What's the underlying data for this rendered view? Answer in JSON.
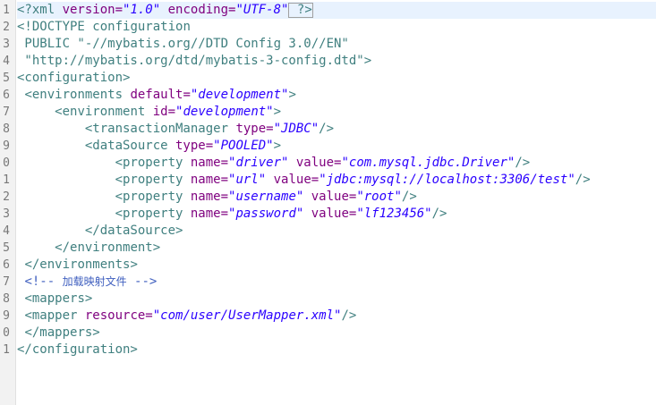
{
  "editor": {
    "line_numbers": [
      "1",
      "2",
      "3",
      "4",
      "5",
      "6",
      "7",
      "8",
      "9",
      "0",
      "1",
      "2",
      "3",
      "4",
      "5",
      "6",
      "7",
      "8",
      "9",
      "0",
      "1"
    ],
    "lines": {
      "l1": {
        "open": "<?xml ",
        "a1": "version=",
        "v1": "\"1.0\"",
        "a2": " encoding=",
        "v2": "\"UTF-8\"",
        "close": " ?>"
      },
      "l2": {
        "open": "<!DOCTYPE ",
        "name": "configuration"
      },
      "l3": {
        "text": " PUBLIC \"-//mybatis.org//DTD Config 3.0//EN\""
      },
      "l4": {
        "text": " \"http://mybatis.org/dtd/mybatis-3-config.dtd\">"
      },
      "l5": {
        "tag": "<configuration>"
      },
      "l6": {
        "indent": " ",
        "tag": "<environments",
        "a1": " default=",
        "v1": "\"development\"",
        "close": ">"
      },
      "l7": {
        "indent": "     ",
        "tag": "<environment",
        "a1": " id=",
        "v1": "\"development\"",
        "close": ">"
      },
      "l8": {
        "indent": "         ",
        "tag": "<transactionManager",
        "a1": " type=",
        "v1": "\"JDBC\"",
        "close": "/>"
      },
      "l9": {
        "indent": "         ",
        "tag": "<dataSource",
        "a1": " type=",
        "v1": "\"POOLED\"",
        "close": ">"
      },
      "l10": {
        "indent": "             ",
        "tag": "<property",
        "a1": " name=",
        "v1": "\"driver\"",
        "a2": " value=",
        "v2": "\"com.mysql.jdbc.Driver\"",
        "close": "/>"
      },
      "l11": {
        "indent": "             ",
        "tag": "<property",
        "a1": " name=",
        "v1": "\"url\"",
        "a2": " value=",
        "v2": "\"jdbc:mysql://localhost:3306/test\"",
        "close": "/>"
      },
      "l12": {
        "indent": "             ",
        "tag": "<property",
        "a1": " name=",
        "v1": "\"username\"",
        "a2": " value=",
        "v2": "\"root\"",
        "close": "/>"
      },
      "l13": {
        "indent": "             ",
        "tag": "<property",
        "a1": " name=",
        "v1": "\"password\"",
        "a2": " value=",
        "v2": "\"lf123456\"",
        "close": "/>"
      },
      "l14": {
        "indent": "         ",
        "tag": "</dataSource>"
      },
      "l15": {
        "indent": "     ",
        "tag": "</environment>"
      },
      "l16": {
        "indent": " ",
        "tag": "</environments>"
      },
      "l17": {
        "indent": " ",
        "open": "<!-- ",
        "text": "加载映射文件",
        "close": " -->"
      },
      "l18": {
        "indent": " ",
        "tag": "<mappers>"
      },
      "l19": {
        "indent": " ",
        "tag": "<mapper",
        "a1": " resource=",
        "v1": "\"com/user/UserMapper.xml\"",
        "close": "/>"
      },
      "l20": {
        "indent": " ",
        "tag": "</mappers>"
      },
      "l21": {
        "tag": "</configuration>"
      }
    }
  }
}
